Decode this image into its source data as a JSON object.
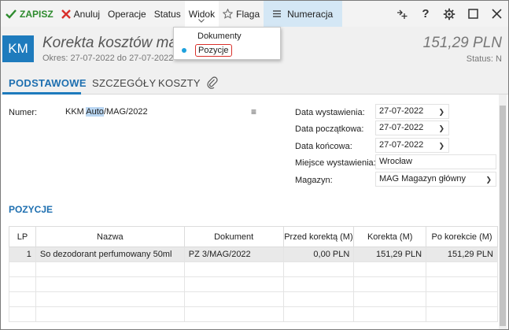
{
  "toolbar": {
    "save": "ZAPISZ",
    "cancel": "Anuluj",
    "operations": "Operacje",
    "status": "Status",
    "view": "Widok",
    "flag": "Flaga",
    "numbering": "Numeracja",
    "right_icons": [
      "add-attachment-icon",
      "help-icon",
      "settings-icon",
      "maximize-icon",
      "close-icon"
    ]
  },
  "view_menu": {
    "items": [
      "Dokumenty",
      "Pozycje"
    ],
    "selected": "Pozycje"
  },
  "header": {
    "badge": "KM",
    "title": "Korekta kosztów magazyn",
    "period": "Okres: 27-07-2022 do 27-07-2022",
    "amount": "151,29 PLN",
    "status": "Status: N"
  },
  "tabs": [
    "PODSTAWOWE",
    "SZCZEGÓŁY",
    "KOSZTY"
  ],
  "form": {
    "number_label": "Numer:",
    "number_prefix": "KKM ",
    "number_highlight": "Auto",
    "number_suffix": "/MAG/2022",
    "issue_date_label": "Data wystawienia:",
    "issue_date": "27-07-2022",
    "start_date_label": "Data początkowa:",
    "start_date": "27-07-2022",
    "end_date_label": "Data końcowa:",
    "end_date": "27-07-2022",
    "place_label": "Miejsce wystawienia:",
    "place": "Wrocław",
    "warehouse_label": "Magazyn:",
    "warehouse": "MAG  Magazyn główny"
  },
  "positions": {
    "title": "POZYCJE",
    "columns": [
      "LP",
      "Nazwa",
      "Dokument",
      "Przed korektą (M)",
      "Korekta (M)",
      "Po korekcie (M)"
    ],
    "rows": [
      [
        "1",
        "So dezodorant perfumowany 50ml",
        "PZ 3/MAG/2022",
        "0,00 PLN",
        "151,29 PLN",
        "151,29 PLN"
      ]
    ]
  }
}
